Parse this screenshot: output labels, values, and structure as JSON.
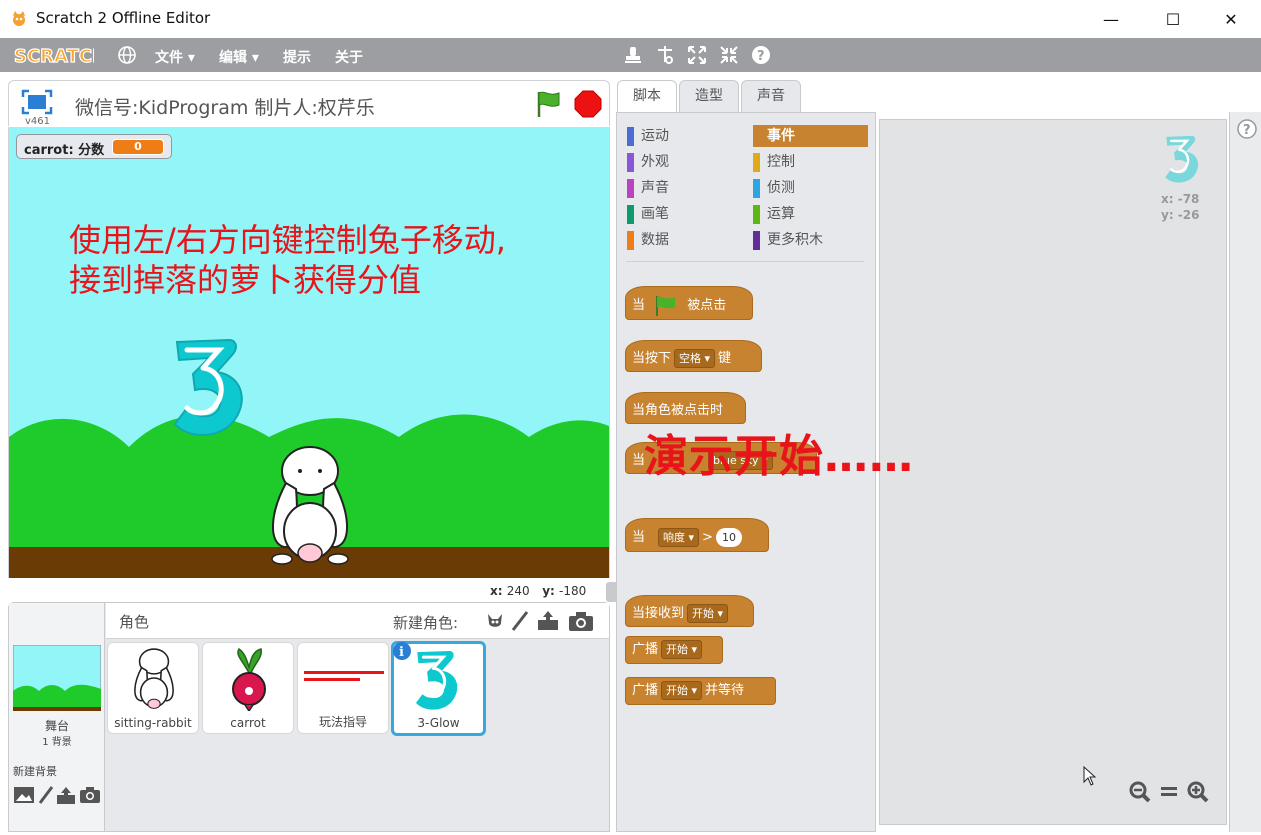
{
  "window": {
    "title": "Scratch 2 Offline Editor",
    "minimize_label": "—",
    "maximize_label": "☐",
    "close_label": "✕"
  },
  "menubar": {
    "logo_text": "SCRATCH",
    "file": "文件",
    "edit": "编辑",
    "tips": "提示",
    "about": "关于"
  },
  "stage": {
    "title": "微信号:KidProgram 制片人:权芹乐",
    "version": "v461",
    "monitor": {
      "label": "carrot: 分数",
      "value": "0"
    },
    "message_line1": "使用左/右方向键控制兔子移动,",
    "message_line2": "接到掉落的萝卜获得分值",
    "coords": {
      "x_label": "x:",
      "x_value": "240",
      "y_label": "y:",
      "y_value": "-180"
    }
  },
  "sprite_pane": {
    "stage_label": "舞台",
    "stage_backdrops": "1 背景",
    "new_backdrop": "新建背景",
    "sprites_title": "角色",
    "new_sprite": "新建角色:",
    "sprites": [
      {
        "name": "sitting-rabbit"
      },
      {
        "name": "carrot"
      },
      {
        "name": "玩法指导"
      },
      {
        "name": "3-Glow"
      }
    ]
  },
  "tabs": [
    "脚本",
    "造型",
    "声音"
  ],
  "categories": [
    {
      "label": "运动",
      "color": "#4a6cd4"
    },
    {
      "label": "事件",
      "color": "#c88330"
    },
    {
      "label": "外观",
      "color": "#8a55d7"
    },
    {
      "label": "控制",
      "color": "#e1a91a"
    },
    {
      "label": "声音",
      "color": "#bb42c3"
    },
    {
      "label": "侦测",
      "color": "#2ca5e2"
    },
    {
      "label": "画笔",
      "color": "#0e9a6c"
    },
    {
      "label": "运算",
      "color": "#5cb712"
    },
    {
      "label": "数据",
      "color": "#ee7d16"
    },
    {
      "label": "更多积木",
      "color": "#632d99"
    }
  ],
  "blocks": {
    "when_flag_prefix": "当",
    "when_flag_suffix": "被点击",
    "when_key_prefix": "当按下",
    "when_key_dd": "空格",
    "when_key_suffix": "键",
    "when_sprite_clicked": "当角色被点击时",
    "when_backdrop_prefix": "当",
    "when_backdrop_dd": "blue sky",
    "when_sensor_prefix": "当",
    "when_sensor_dd": "响度",
    "when_sensor_op": ">",
    "when_sensor_value": "10",
    "when_receive_prefix": "当接收到",
    "when_receive_dd": "开始",
    "broadcast_prefix": "广播",
    "broadcast_dd": "开始",
    "broadcast_wait_prefix": "广播",
    "broadcast_wait_dd": "开始",
    "broadcast_wait_suffix": "并等待"
  },
  "script_area": {
    "sprite_x": "x: -78",
    "sprite_y": "y: -26"
  },
  "overlay": "演示开始……"
}
